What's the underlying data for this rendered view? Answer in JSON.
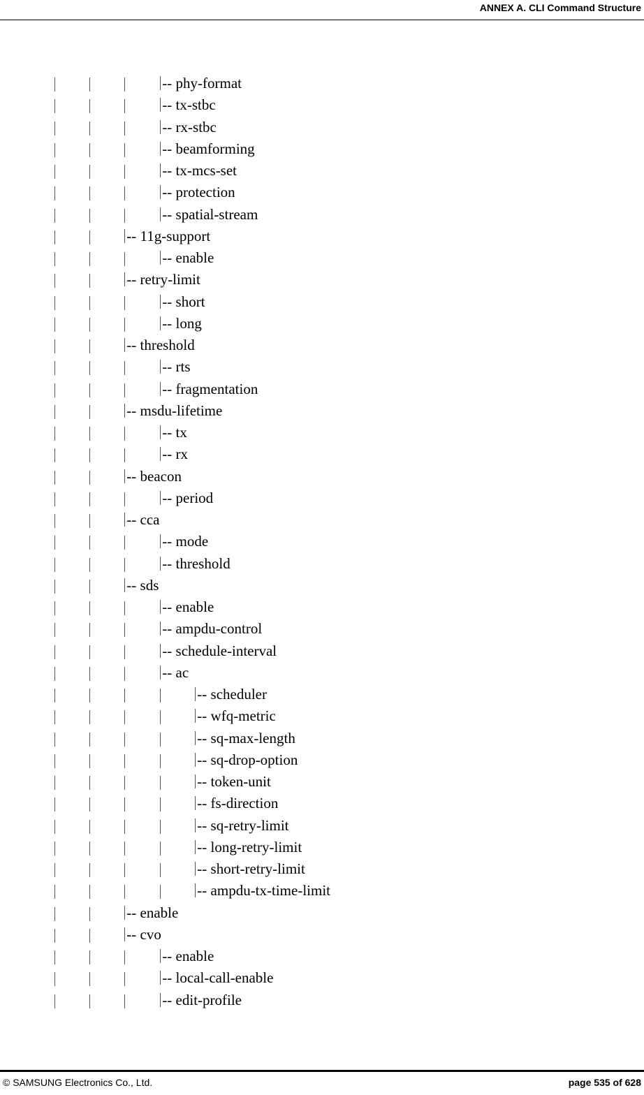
{
  "header": {
    "title": "ANNEX A. CLI Command Structure"
  },
  "tree": [
    {
      "depth": 3,
      "label": "phy-format"
    },
    {
      "depth": 3,
      "label": "tx-stbc"
    },
    {
      "depth": 3,
      "label": "rx-stbc"
    },
    {
      "depth": 3,
      "label": "beamforming"
    },
    {
      "depth": 3,
      "label": "tx-mcs-set"
    },
    {
      "depth": 3,
      "label": "protection"
    },
    {
      "depth": 3,
      "label": "spatial-stream"
    },
    {
      "depth": 2,
      "label": "11g-support"
    },
    {
      "depth": 3,
      "label": "enable"
    },
    {
      "depth": 2,
      "label": "retry-limit"
    },
    {
      "depth": 3,
      "label": "short"
    },
    {
      "depth": 3,
      "label": "long"
    },
    {
      "depth": 2,
      "label": "threshold"
    },
    {
      "depth": 3,
      "label": "rts"
    },
    {
      "depth": 3,
      "label": "fragmentation"
    },
    {
      "depth": 2,
      "label": "msdu-lifetime"
    },
    {
      "depth": 3,
      "label": "tx"
    },
    {
      "depth": 3,
      "label": "rx"
    },
    {
      "depth": 2,
      "label": "beacon"
    },
    {
      "depth": 3,
      "label": "period"
    },
    {
      "depth": 2,
      "label": "cca"
    },
    {
      "depth": 3,
      "label": "mode"
    },
    {
      "depth": 3,
      "label": "threshold"
    },
    {
      "depth": 2,
      "label": "sds"
    },
    {
      "depth": 3,
      "label": "enable"
    },
    {
      "depth": 3,
      "label": "ampdu-control"
    },
    {
      "depth": 3,
      "label": "schedule-interval"
    },
    {
      "depth": 3,
      "label": "ac"
    },
    {
      "depth": 4,
      "label": "scheduler"
    },
    {
      "depth": 4,
      "label": "wfq-metric"
    },
    {
      "depth": 4,
      "label": "sq-max-length"
    },
    {
      "depth": 4,
      "label": "sq-drop-option"
    },
    {
      "depth": 4,
      "label": "token-unit"
    },
    {
      "depth": 4,
      "label": "fs-direction"
    },
    {
      "depth": 4,
      "label": "sq-retry-limit"
    },
    {
      "depth": 4,
      "label": "long-retry-limit"
    },
    {
      "depth": 4,
      "label": "short-retry-limit"
    },
    {
      "depth": 4,
      "label": "ampdu-tx-time-limit"
    },
    {
      "depth": 2,
      "label": "enable"
    },
    {
      "depth": 2,
      "label": "cvo"
    },
    {
      "depth": 3,
      "label": "enable"
    },
    {
      "depth": 3,
      "label": "local-call-enable"
    },
    {
      "depth": 3,
      "label": "edit-profile"
    }
  ],
  "branch_prefix": "-- ",
  "footer": {
    "copyright": "© SAMSUNG Electronics Co., Ltd.",
    "page": "page 535 of 628"
  }
}
